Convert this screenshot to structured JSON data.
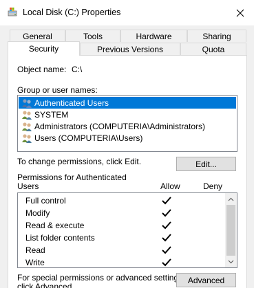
{
  "window": {
    "title": "Local Disk (C:) Properties",
    "title_icon": "drive-properties-icon",
    "close_icon": "close-icon"
  },
  "tabs": {
    "row1": [
      "General",
      "Tools",
      "Hardware",
      "Sharing"
    ],
    "row2": [
      "Security",
      "Previous Versions",
      "Quota"
    ],
    "active": "Security"
  },
  "object": {
    "label": "Object name:",
    "value": "C:\\"
  },
  "groups": {
    "label": "Group or user names:",
    "items": [
      {
        "label": "Authenticated Users",
        "icon": "user-group-icon",
        "selected": true
      },
      {
        "label": "SYSTEM",
        "icon": "user-group-icon",
        "selected": false
      },
      {
        "label": "Administrators (COMPUTERIA\\Administrators)",
        "icon": "user-group-icon",
        "selected": false
      },
      {
        "label": "Users (COMPUTERIA\\Users)",
        "icon": "user-group-icon",
        "selected": false
      }
    ]
  },
  "change_hint": "To change permissions, click Edit.",
  "edit_button": "Edit...",
  "permissions": {
    "title_line1": "Permissions for Authenticated",
    "title_line2": "Users",
    "allow_header": "Allow",
    "deny_header": "Deny",
    "items": [
      {
        "name": "Full control",
        "allow": true,
        "deny": false
      },
      {
        "name": "Modify",
        "allow": true,
        "deny": false
      },
      {
        "name": "Read & execute",
        "allow": true,
        "deny": false
      },
      {
        "name": "List folder contents",
        "allow": true,
        "deny": false
      },
      {
        "name": "Read",
        "allow": true,
        "deny": false
      },
      {
        "name": "Write",
        "allow": true,
        "deny": false
      }
    ]
  },
  "special": {
    "line1": "For special permissions or advanced settings,",
    "line2": "click Advanced."
  },
  "advanced_button": "Advanced",
  "colors": {
    "selection": "#0078d7",
    "window_bg": "#f0f0f0"
  }
}
